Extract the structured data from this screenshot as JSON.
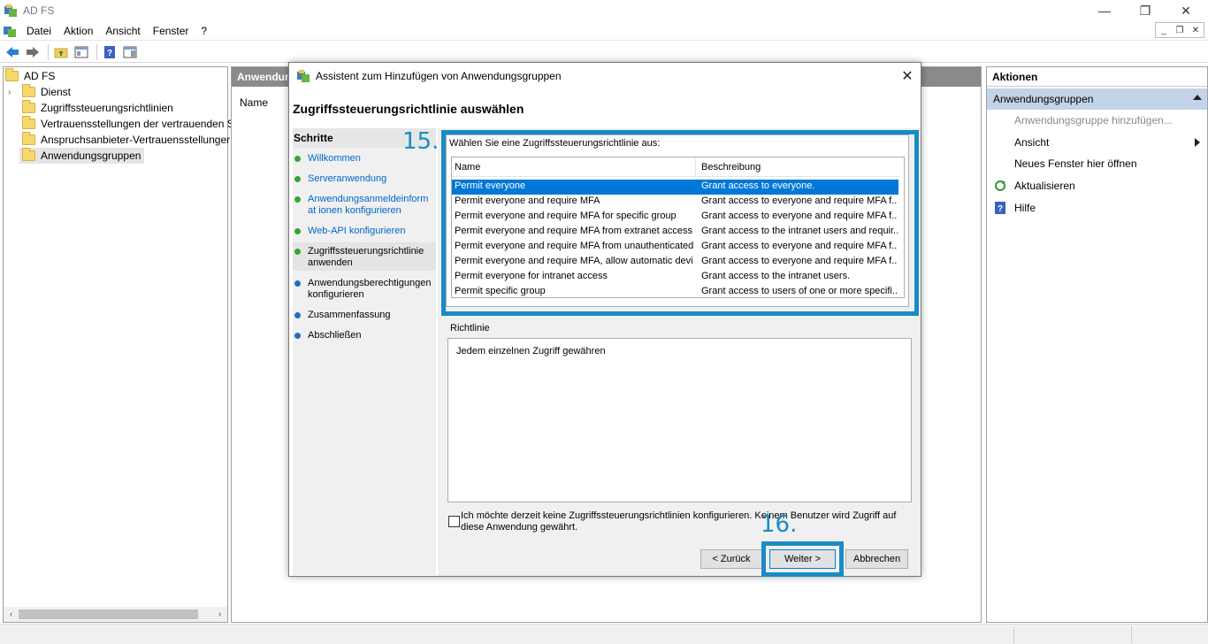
{
  "window": {
    "title": "AD FS",
    "controls": {
      "minimize": "—",
      "restore": "❐",
      "close": "✕"
    }
  },
  "menubar": {
    "items": [
      "Datei",
      "Aktion",
      "Ansicht",
      "Fenster",
      "?"
    ]
  },
  "tree": {
    "root": "AD FS",
    "items": [
      {
        "label": "Dienst",
        "expandable": true
      },
      {
        "label": "Zugriffssteuerungsrichtlinien"
      },
      {
        "label": "Vertrauensstellungen der vertrauenden S"
      },
      {
        "label": "Anspruchsanbieter-Vertrauensstellunger"
      },
      {
        "label": "Anwendungsgruppen",
        "selected": true
      }
    ]
  },
  "middle": {
    "header": "Anwendun",
    "column": "Name"
  },
  "actions": {
    "header": "Aktionen",
    "section": "Anwendungsgruppen",
    "items": [
      {
        "label": "Anwendungsgruppe hinzufügen...",
        "disabled": true
      },
      {
        "label": "Ansicht",
        "submenu": true
      },
      {
        "label": "Neues Fenster hier öffnen"
      },
      {
        "label": "Aktualisieren",
        "icon": "refresh-icon"
      },
      {
        "label": "Hilfe",
        "icon": "help-icon"
      }
    ]
  },
  "dialog": {
    "title": "Assistent zum Hinzufügen von Anwendungsgruppen",
    "heading": "Zugriffssteuerungsrichtlinie auswählen",
    "steps_header": "Schritte",
    "steps": [
      {
        "label": "Willkommen",
        "state": "done"
      },
      {
        "label": "Serveranwendung",
        "state": "done"
      },
      {
        "label": "Anwendungsanmeldeinformat ionen konfigurieren",
        "state": "done"
      },
      {
        "label": "Web-API konfigurieren",
        "state": "done"
      },
      {
        "label": "Zugriffssteuerungsrichtlinie anwenden",
        "state": "current"
      },
      {
        "label": "Anwendungsberechtigungen konfigurieren",
        "state": "pending"
      },
      {
        "label": "Zusammenfassung",
        "state": "pending"
      },
      {
        "label": "Abschließen",
        "state": "pending"
      }
    ],
    "policy_label": "Wählen Sie eine Zugriffssteuerungsrichtlinie aus:",
    "columns": [
      "Name",
      "Beschreibung"
    ],
    "policies": [
      {
        "name": "Permit everyone",
        "desc": "Grant access to everyone.",
        "selected": true
      },
      {
        "name": "Permit everyone and require MFA",
        "desc": "Grant access to everyone and require MFA f..."
      },
      {
        "name": "Permit everyone and require MFA for specific group",
        "desc": "Grant access to everyone and require MFA f..."
      },
      {
        "name": "Permit everyone and require MFA from extranet access",
        "desc": "Grant access to the intranet users and requir..."
      },
      {
        "name": "Permit everyone and require MFA from unauthenticated ...",
        "desc": "Grant access to everyone and require MFA f..."
      },
      {
        "name": "Permit everyone and require MFA, allow automatic devi...",
        "desc": "Grant access to everyone and require MFA f..."
      },
      {
        "name": "Permit everyone for intranet access",
        "desc": "Grant access to the intranet users."
      },
      {
        "name": "Permit specific group",
        "desc": "Grant access to users of one or more specifi..."
      }
    ],
    "richtlinie_label": "Richtlinie",
    "richtlinie_text": "Jedem einzelnen  Zugriff gewähren",
    "checkbox_label": "Ich möchte derzeit keine Zugriffssteuerungsrichtlinien konfigurieren. Keinem Benutzer wird Zugriff auf diese Anwendung gewährt.",
    "checkbox_checked": false,
    "buttons": {
      "back": "< Zurück",
      "next": "Weiter >",
      "cancel": "Abbrechen"
    },
    "annotations": {
      "step15": "15.",
      "step16": "16."
    },
    "close": "✕"
  },
  "colors": {
    "annotation": "#1a8bc5",
    "selection": "#0078d7",
    "done_dot": "#3aa335",
    "pending_dot": "#1e6ec8",
    "actions_section": "#c3d3e8"
  }
}
